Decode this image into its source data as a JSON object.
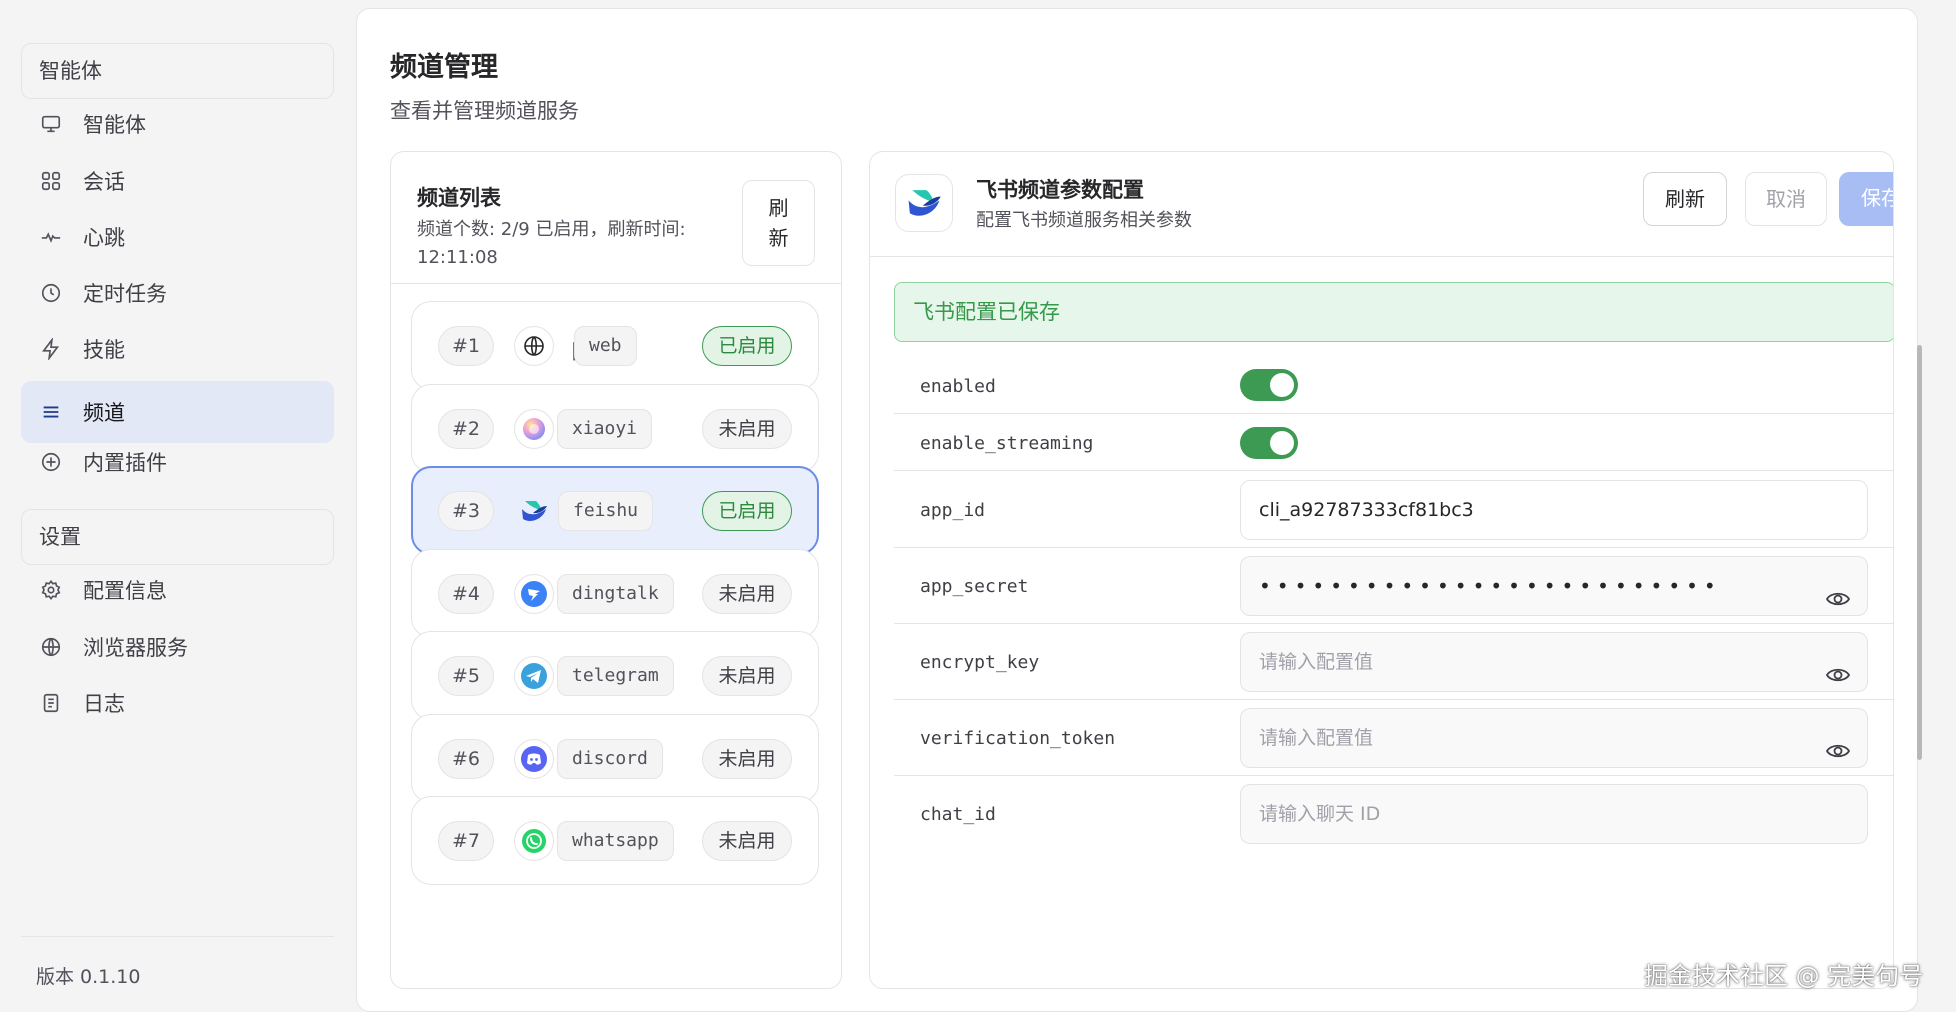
{
  "sidebar": {
    "groups": [
      {
        "label": "智能体"
      },
      {
        "label": "设置"
      }
    ],
    "items": [
      {
        "label": "智能体",
        "icon": "monitor-icon"
      },
      {
        "label": "会话",
        "icon": "chat-icon"
      },
      {
        "label": "心跳",
        "icon": "heartbeat-icon"
      },
      {
        "label": "定时任务",
        "icon": "clock-icon"
      },
      {
        "label": "技能",
        "icon": "lightning-icon"
      },
      {
        "label": "频道",
        "icon": "list-icon",
        "active": true
      },
      {
        "label": "内置插件",
        "icon": "plus-circle-icon"
      },
      {
        "label": "配置信息",
        "icon": "gear-icon"
      },
      {
        "label": "浏览器服务",
        "icon": "globe-icon"
      },
      {
        "label": "日志",
        "icon": "document-icon"
      }
    ],
    "version": "版本 0.1.10"
  },
  "page": {
    "title": "频道管理",
    "subtitle": "查看并管理频道服务"
  },
  "channel_list": {
    "title": "频道列表",
    "meta": "频道个数: 2/9 已启用，刷新时间: 12:11:08",
    "refresh_label": "刷\n新",
    "channels": [
      {
        "num": "#1",
        "icon": "globe-icon",
        "name": "网",
        "key": "web",
        "status": "已启用",
        "enabled": true
      },
      {
        "num": "#2",
        "icon": "xiaoyi-icon",
        "name": "",
        "key": "xiaoyi",
        "status": "未启用",
        "enabled": false
      },
      {
        "num": "#3",
        "icon": "feishu-icon",
        "name": "",
        "key": "feishu",
        "status": "已启用",
        "enabled": true,
        "selected": true
      },
      {
        "num": "#4",
        "icon": "dingtalk-icon",
        "name": "",
        "key": "dingtalk",
        "status": "未启用",
        "enabled": false
      },
      {
        "num": "#5",
        "icon": "telegram-icon",
        "name": "",
        "key": "telegram",
        "status": "未启用",
        "enabled": false
      },
      {
        "num": "#6",
        "icon": "discord-icon",
        "name": "",
        "key": "discord",
        "status": "未启用",
        "enabled": false
      },
      {
        "num": "#7",
        "icon": "whatsapp-icon",
        "name": "",
        "key": "whatsapp",
        "status": "未启用",
        "enabled": false
      }
    ]
  },
  "config": {
    "title": "飞书频道参数配置",
    "subtitle": "配置飞书频道服务相关参数",
    "buttons": {
      "refresh": "刷新",
      "cancel": "取消",
      "save": "保存"
    },
    "alert": "飞书配置已保存",
    "fields": [
      {
        "label": "enabled",
        "type": "toggle",
        "value": true
      },
      {
        "label": "enable_streaming",
        "type": "toggle",
        "value": true
      },
      {
        "label": "app_id",
        "type": "text",
        "value": "cli_a92787333cf81bc3",
        "placeholder": ""
      },
      {
        "label": "app_secret",
        "type": "password",
        "value": "••••••••••••••••••••••••••",
        "placeholder": ""
      },
      {
        "label": "encrypt_key",
        "type": "password",
        "value": "",
        "placeholder": "请输入配置值"
      },
      {
        "label": "verification_token",
        "type": "password",
        "value": "",
        "placeholder": "请输入配置值"
      },
      {
        "label": "chat_id",
        "type": "text",
        "value": "",
        "placeholder": "请输入聊天 ID"
      }
    ]
  },
  "colors": {
    "accent": "#a8bdf4",
    "active_nav": "#e2e8f6",
    "enabled_green": "#3d9a52",
    "alert_bg": "#e6f6ea"
  },
  "watermark": "掘金技术社区 @ 完美句号"
}
